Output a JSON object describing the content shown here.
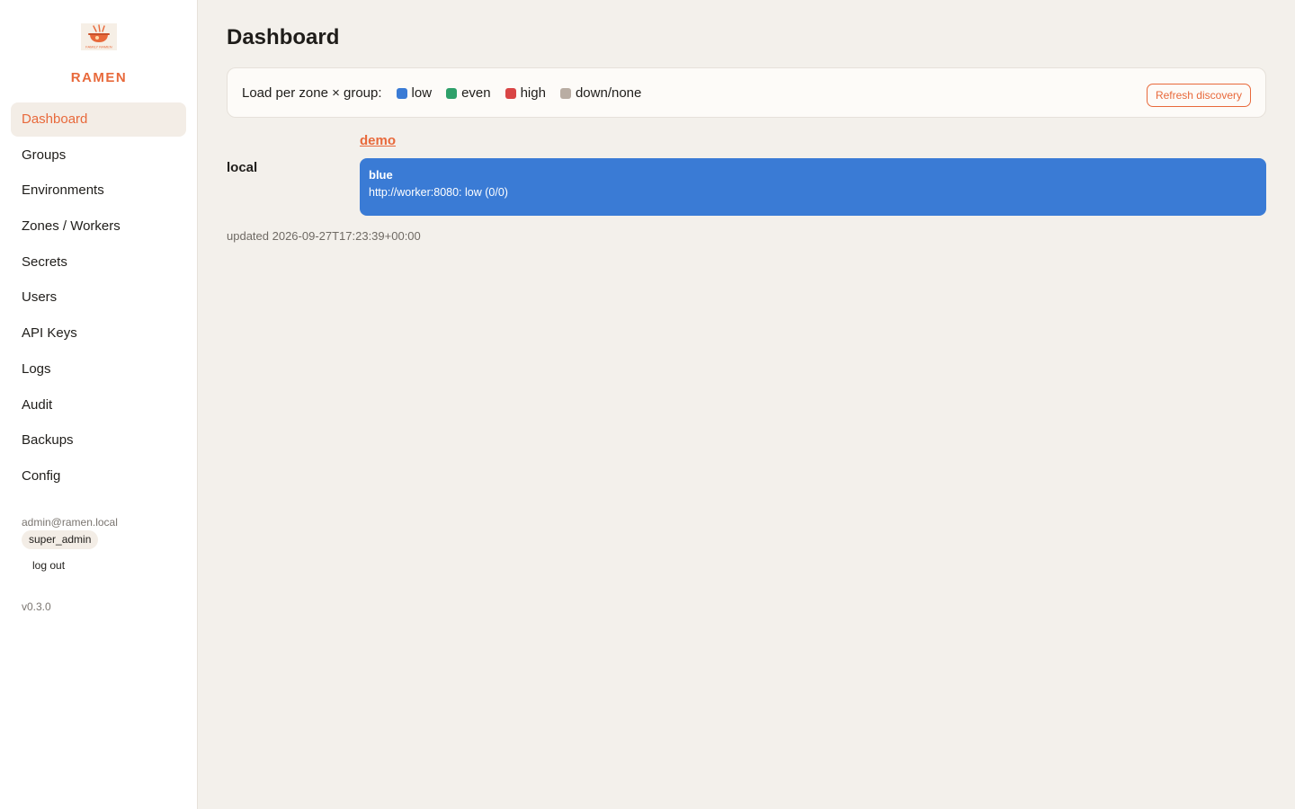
{
  "sidebar": {
    "brand": "RAMEN",
    "logo_text": "FAMILY RAMEN",
    "nav": [
      {
        "label": "Dashboard",
        "active": true
      },
      {
        "label": "Groups"
      },
      {
        "label": "Environments"
      },
      {
        "label": "Zones / Workers"
      },
      {
        "label": "Secrets"
      },
      {
        "label": "Users"
      },
      {
        "label": "API Keys"
      },
      {
        "label": "Logs"
      },
      {
        "label": "Audit"
      },
      {
        "label": "Backups"
      },
      {
        "label": "Config"
      }
    ],
    "user": {
      "email": "admin@ramen.local",
      "role": "super_admin",
      "logout": "log out"
    },
    "version": "v0.3.0"
  },
  "main": {
    "title": "Dashboard",
    "legend": {
      "title": "Load per zone × group:",
      "items": [
        {
          "label": "low",
          "color": "#3a7bd5"
        },
        {
          "label": "even",
          "color": "#2ea06a"
        },
        {
          "label": "high",
          "color": "#d94545"
        },
        {
          "label": "down/none",
          "color": "#b9ada3"
        }
      ]
    },
    "refresh_label": "Refresh discovery",
    "group": "demo",
    "zone": "local",
    "cell": {
      "title": "blue",
      "detail": "http://worker:8080: low (0/0)",
      "color": "#3a7bd5"
    },
    "updated": "updated 2026-09-27T17:23:39+00:00"
  },
  "colors": {
    "accent": "#e8693b",
    "background": "#f3f0eb"
  }
}
